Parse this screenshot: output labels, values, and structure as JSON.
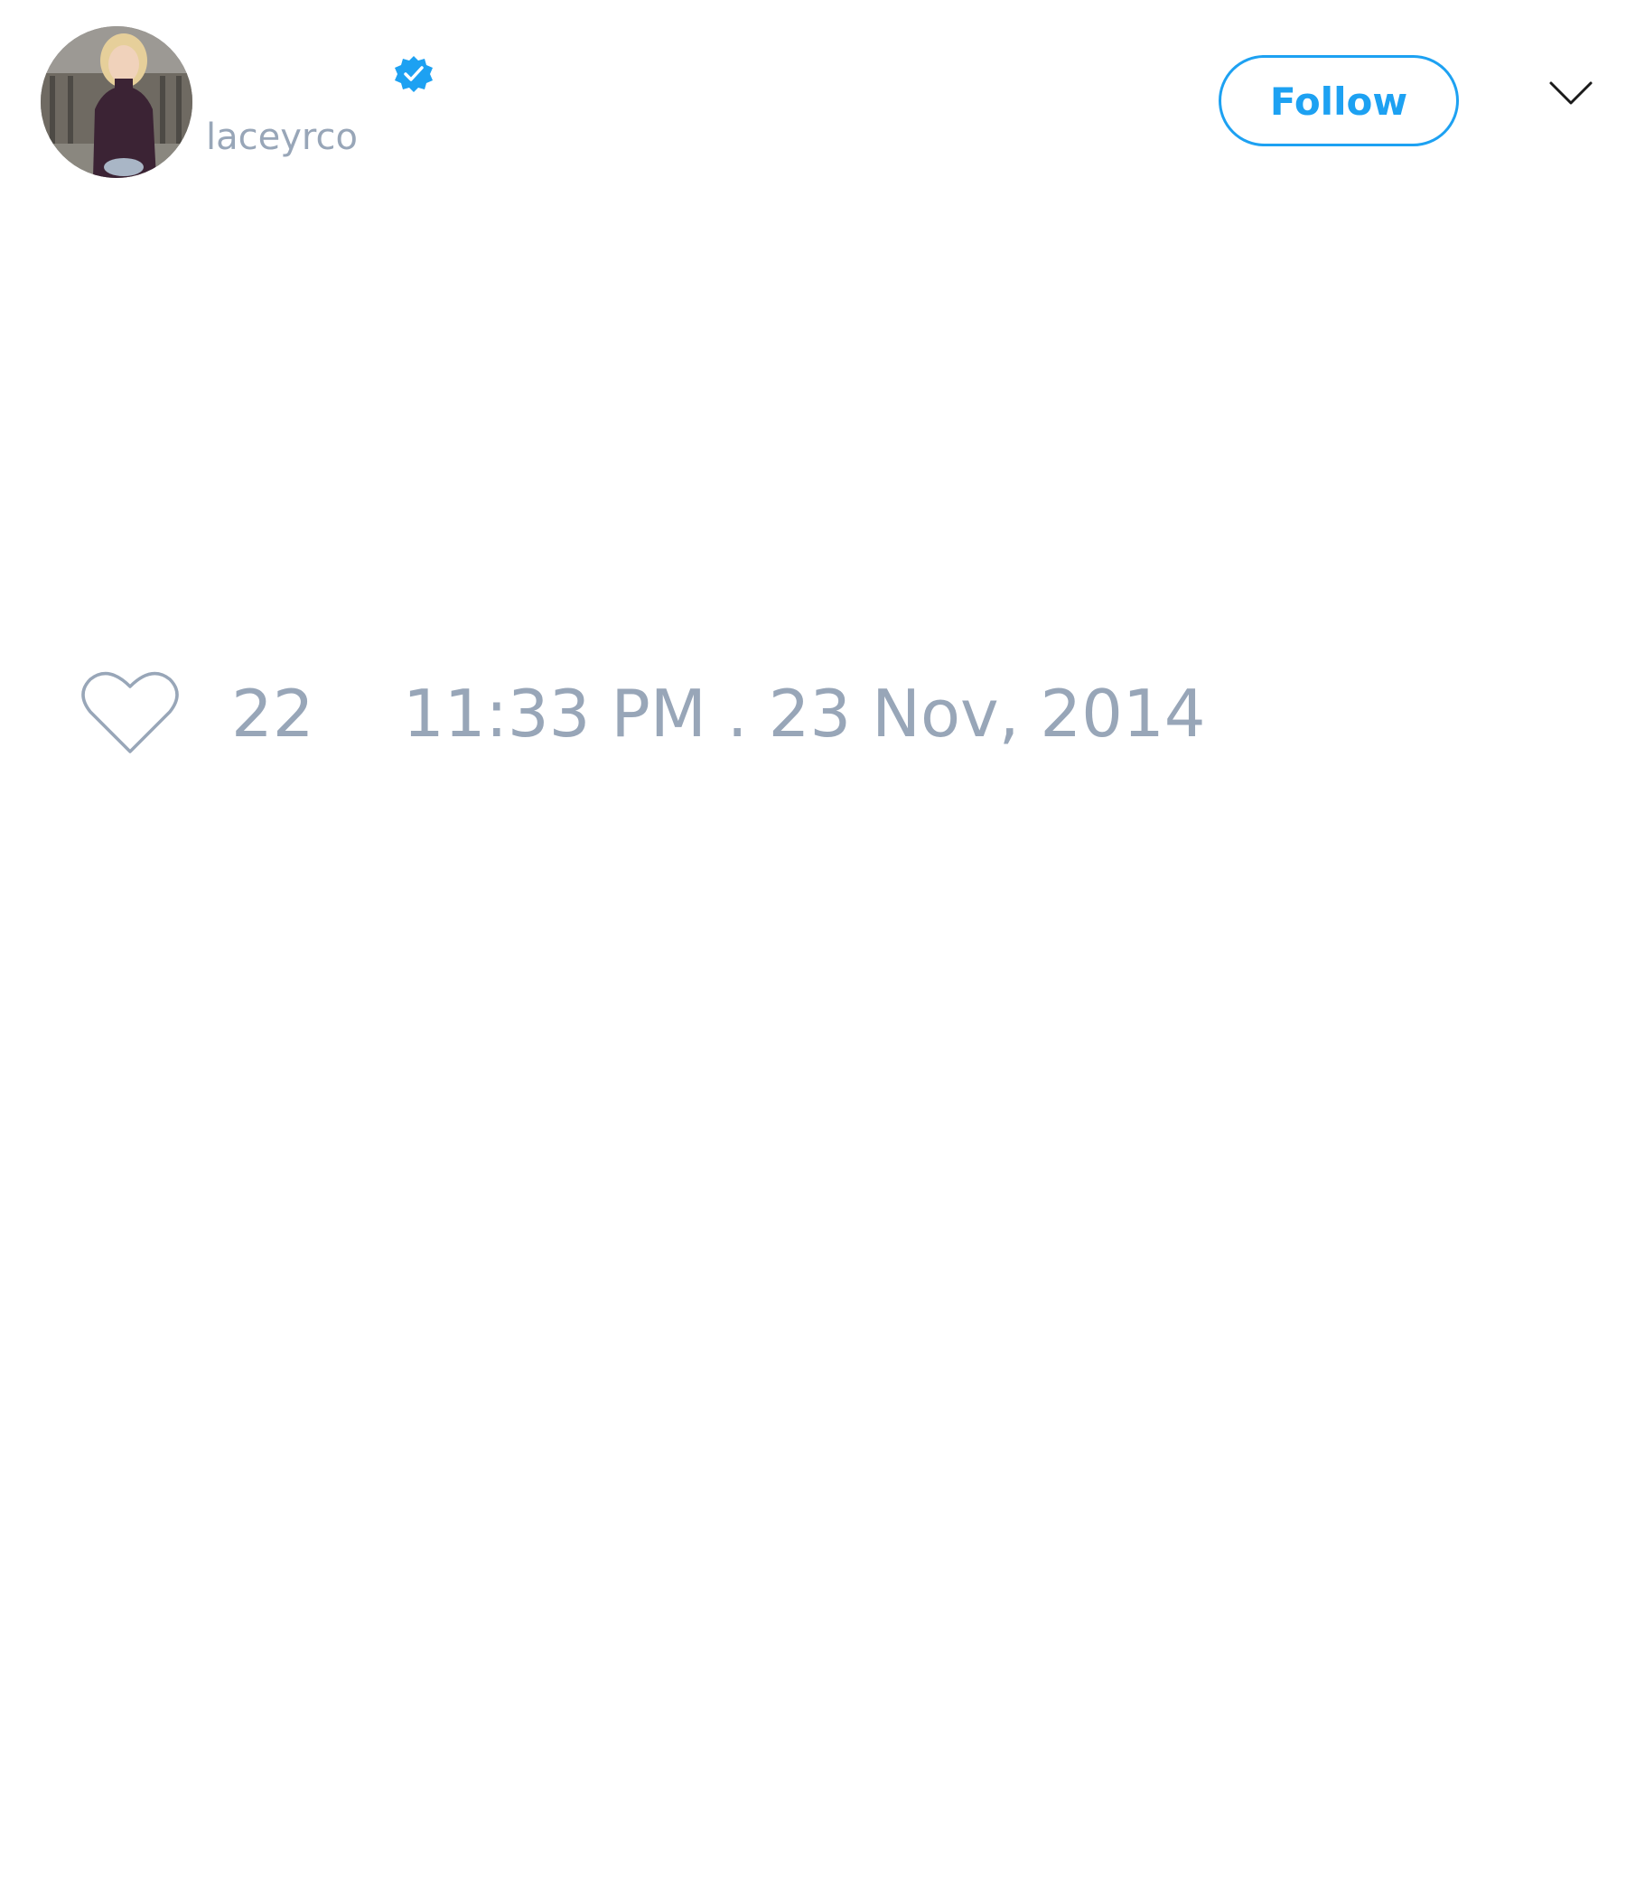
{
  "tweet": {
    "author": {
      "display_name": "",
      "handle": "laceyrco",
      "verified": true,
      "avatar": "profile-photo"
    },
    "follow_label": "Follow",
    "menu_icon": "chevron-down-icon",
    "like_icon": "heart-outline-icon",
    "like_count": "22",
    "timestamp": "11:33 PM . 23 Nov, 2014"
  },
  "colors": {
    "accent": "#1da1f2",
    "muted_text": "#98a6b8",
    "background": "#ffffff",
    "icon_dark": "#1a1a1a"
  }
}
